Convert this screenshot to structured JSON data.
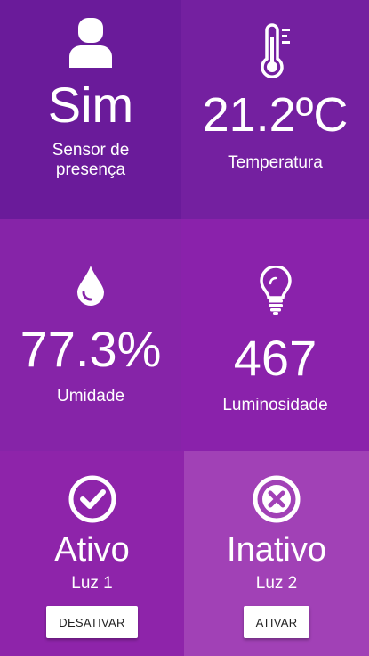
{
  "presence": {
    "value": "Sim",
    "label": "Sensor de presença",
    "icon": "user-icon"
  },
  "temperature": {
    "value": "21.2ºC",
    "label": "Temperatura",
    "icon": "thermometer-icon"
  },
  "humidity": {
    "value": "77.3%",
    "label": "Umidade",
    "icon": "water-drop-icon"
  },
  "luminosity": {
    "value": "467",
    "label": "Luminosidade",
    "icon": "lightbulb-icon"
  },
  "light1": {
    "status": "Ativo",
    "label": "Luz 1",
    "button": "DESATIVAR",
    "icon": "check-circle-icon"
  },
  "light2": {
    "status": "Inativo",
    "label": "Luz 2",
    "button": "ATIVAR",
    "icon": "close-circle-icon"
  },
  "colors": {
    "tile_presence": "#6a1b9a",
    "tile_temperature": "#7420a0",
    "tile_humidity": "#8624a8",
    "tile_luminosity": "#8a22ab",
    "tile_light1": "#8e24aa",
    "tile_light2": "#a141b6",
    "text": "#ffffff",
    "button_bg": "#ffffff"
  }
}
